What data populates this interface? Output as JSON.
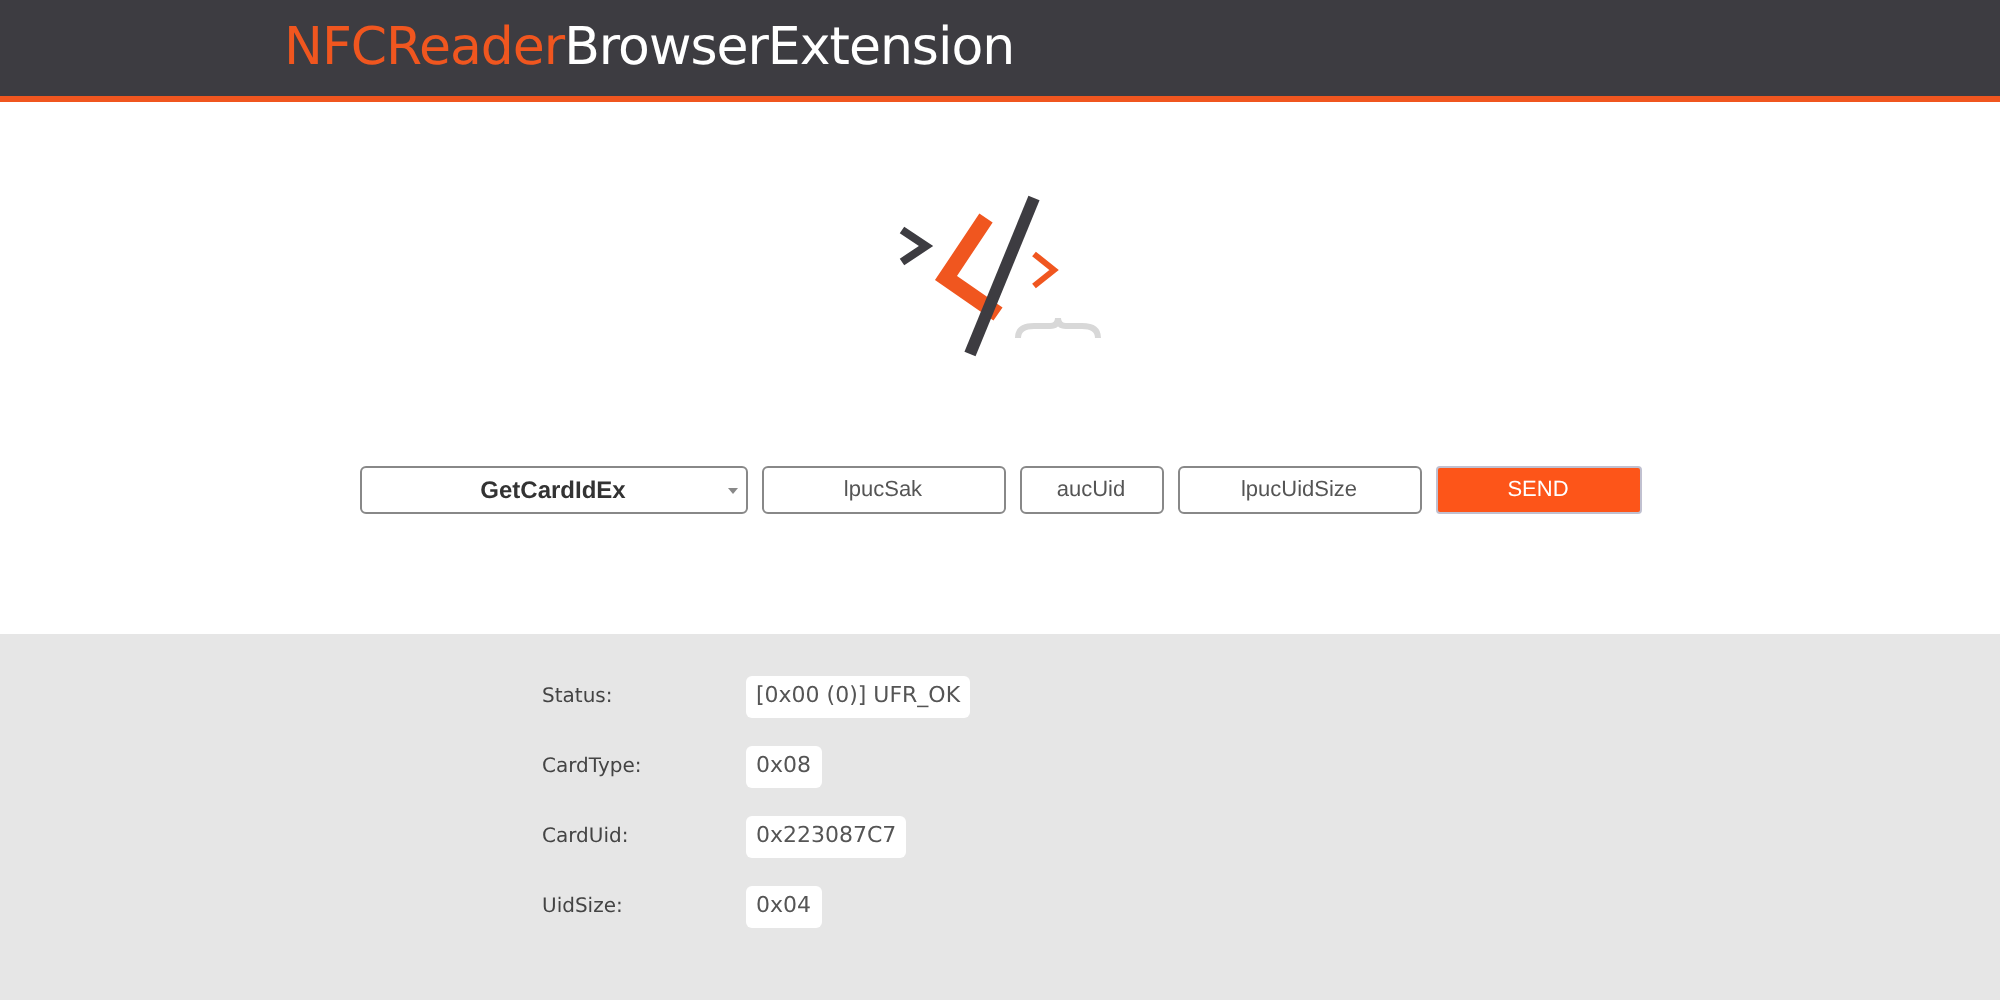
{
  "header": {
    "title_accent": "NFCReader",
    "title_rest": "BrowserExtension"
  },
  "form": {
    "function_select": "GetCardIdEx",
    "fields": [
      {
        "placeholder": "lpucSak"
      },
      {
        "placeholder": "aucUid"
      },
      {
        "placeholder": "lpucUidSize"
      }
    ],
    "send_button": "SEND"
  },
  "results": [
    {
      "label": "Status:",
      "value": "[0x00 (0)] UFR_OK"
    },
    {
      "label": "CardType:",
      "value": "0x08"
    },
    {
      "label": "CardUid:",
      "value": "0x223087C7"
    },
    {
      "label": "UidSize:",
      "value": "0x04"
    }
  ]
}
